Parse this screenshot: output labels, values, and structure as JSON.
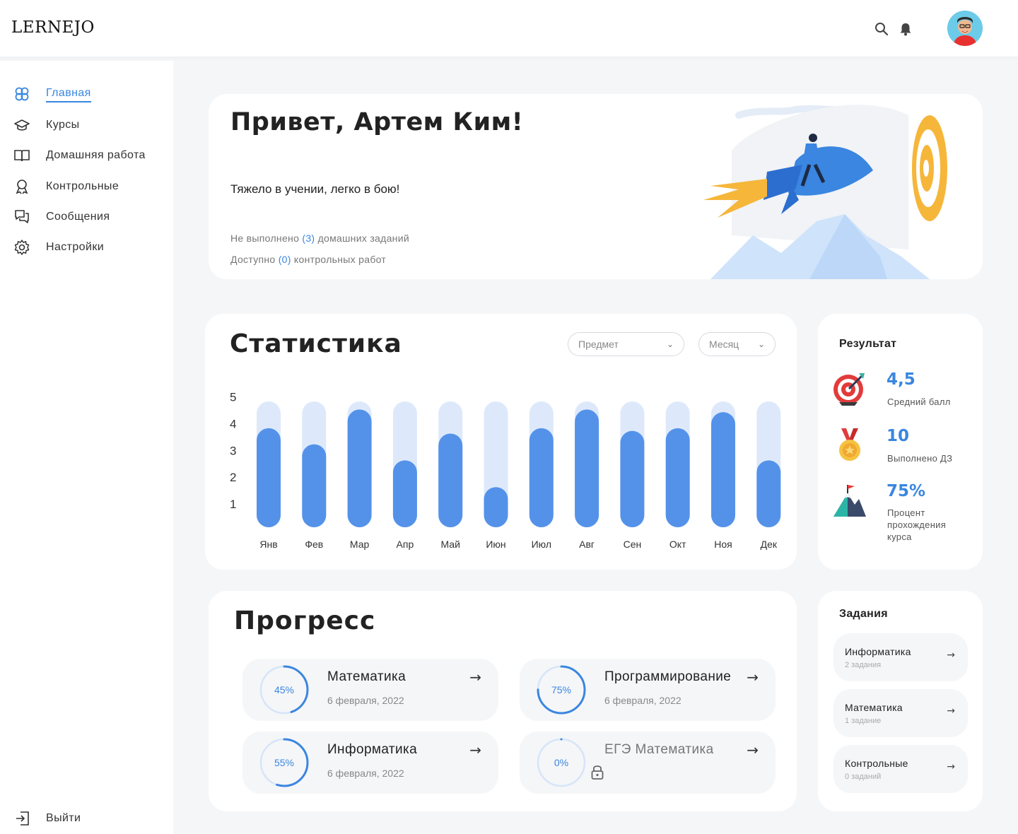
{
  "header": {
    "logo": "LERNEJO",
    "search_icon": "search-icon",
    "bell_icon": "bell-icon",
    "avatar": "user-avatar"
  },
  "sidebar": {
    "items": [
      {
        "label": "Главная",
        "icon": "hexagons-icon",
        "active": true
      },
      {
        "label": "Курсы",
        "icon": "graduation-cap-icon"
      },
      {
        "label": "Домашняя работа",
        "icon": "book-icon"
      },
      {
        "label": "Контрольные",
        "icon": "award-icon"
      },
      {
        "label": "Сообщения",
        "icon": "chat-icon"
      },
      {
        "label": "Настройки",
        "icon": "gear-icon"
      }
    ],
    "logout": "Выйти"
  },
  "hero": {
    "title": "Привет, Артем Ким!",
    "quote": "Тяжело в учении, легко в бою!",
    "line1_prefix": "Не выполнено",
    "line1_count": "(3)",
    "line1_suffix": "домашних заданий",
    "line2_prefix": "Доступно",
    "line2_count": "(0)",
    "line2_suffix": "контрольных работ"
  },
  "stats": {
    "title": "Статистика",
    "subject_select": "Предмет",
    "month_select": "Месяц"
  },
  "chart_data": {
    "type": "bar",
    "categories": [
      "Янв",
      "Фев",
      "Мар",
      "Апр",
      "Май",
      "Июн",
      "Июл",
      "Авг",
      "Сен",
      "Окт",
      "Ноя",
      "Дек"
    ],
    "values": [
      4.2,
      3.6,
      4.9,
      3.0,
      4.0,
      2.0,
      4.2,
      4.9,
      4.1,
      4.2,
      4.8,
      3.0
    ],
    "ylim": [
      1,
      5
    ],
    "yticks": [
      "5",
      "4",
      "3",
      "2",
      "1"
    ],
    "colors": {
      "bar": "#5492ea",
      "track": "#dde9fb"
    }
  },
  "result": {
    "title": "Результат",
    "items": [
      {
        "value": "4,5",
        "label": "Средний балл",
        "icon": "target-icon"
      },
      {
        "value": "10",
        "label": "Выполнено ДЗ",
        "icon": "medal-icon"
      },
      {
        "value": "75%",
        "label": "Процент прохождения курса",
        "icon": "mountain-flag-icon"
      }
    ]
  },
  "tasks": {
    "title": "Задания",
    "items": [
      {
        "name": "Информатика",
        "sub": "2 задания"
      },
      {
        "name": "Математика",
        "sub": "1 задание"
      },
      {
        "name": "Контрольные",
        "sub": "0 заданий"
      }
    ]
  },
  "progress": {
    "title": "Прогресс",
    "items": [
      {
        "name": "Математика",
        "date": "6 февраля, 2022",
        "percent": "45%",
        "fraction": 0.45
      },
      {
        "name": "Программирование",
        "date": "6 февраля, 2022",
        "percent": "75%",
        "fraction": 0.75
      },
      {
        "name": "Информатика",
        "date": "6 февраля, 2022",
        "percent": "55%",
        "fraction": 0.55
      },
      {
        "name": "ЕГЭ Математика",
        "date": "",
        "percent": "0%",
        "fraction": 0,
        "locked": true
      }
    ]
  },
  "colors": {
    "accent": "#3a86e0",
    "bar": "#5492ea",
    "track": "#dde9fb",
    "background": "#f5f6f8"
  }
}
